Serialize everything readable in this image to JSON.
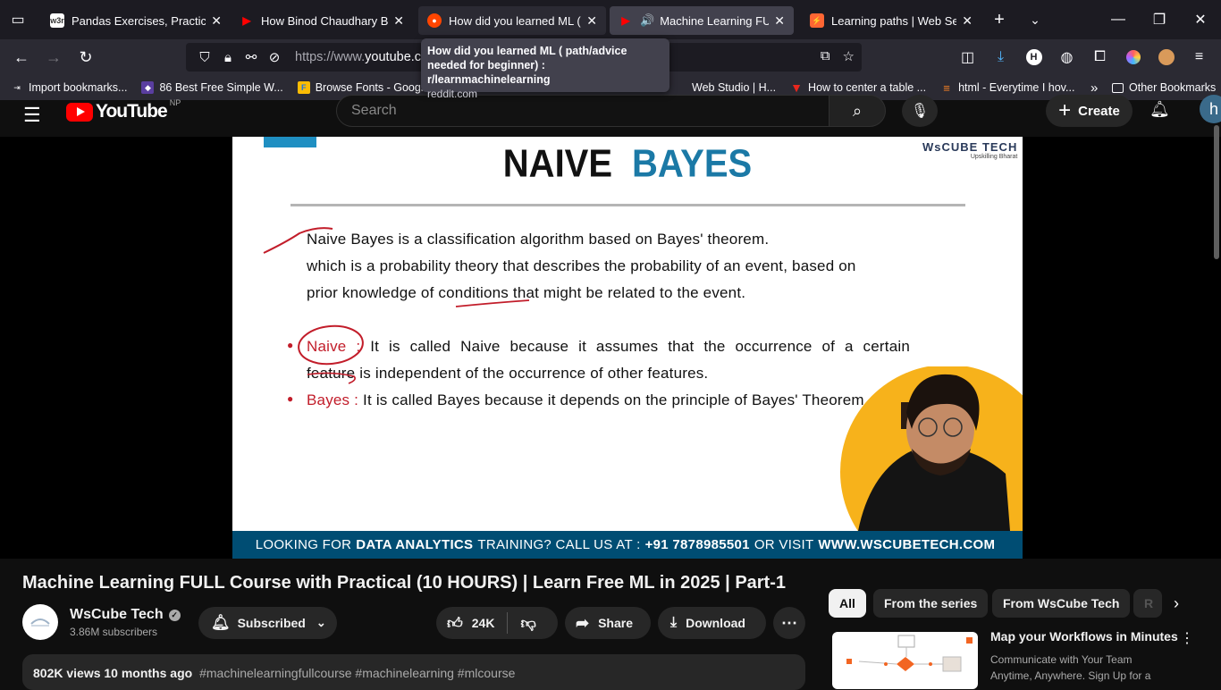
{
  "browser": {
    "tabs": [
      {
        "label": "Pandas Exercises, Practice, Sol",
        "favicon_text": "w3r",
        "favicon_color": "#fff"
      },
      {
        "label": "How Binod Chaudhary Becam",
        "favicon_text": "▶",
        "favicon_color": "#ff0000"
      },
      {
        "label": "How did you learned ML ( p",
        "favicon_text": "●",
        "favicon_color": "#ff4500"
      },
      {
        "label": "Machine Learning FULL C",
        "favicon_text": "▶",
        "favicon_color": "#ff0000"
      },
      {
        "label": "Learning paths | Web Security",
        "favicon_text": "⚡",
        "favicon_color": "#ff6633"
      }
    ],
    "url_prefix": "https://www.",
    "url_domain": "youtube.com",
    "tooltip": {
      "title": "How did you learned ML ( path/advice needed for beginner) : r/learnmachinelearning",
      "domain": "reddit.com"
    },
    "bookmarks": [
      {
        "label": "Import bookmarks...",
        "icon": "⇥"
      },
      {
        "label": "86 Best Free Simple W...",
        "icon": "◆"
      },
      {
        "label": "Browse Fonts - Googl...",
        "icon": "F"
      },
      {
        "label": "Web Studio | H...",
        "icon": ""
      },
      {
        "label": "How to center a table ...",
        "icon": "▼"
      },
      {
        "label": "html - Everytime I hov...",
        "icon": "≡"
      }
    ],
    "bookmarks_other": "Other Bookmarks"
  },
  "youtube": {
    "logo_text": "YouTube",
    "region": "NP",
    "search_placeholder": "Search",
    "create_label": "Create",
    "avatar_letter": "h"
  },
  "slide": {
    "title_part1": "NAIVE",
    "title_part2": "BAYES",
    "logo_line1": "WsCUBE TECH",
    "logo_line2": "Upskilling Bharat",
    "bullet1": "Naive Bayes is a classification algorithm based on Bayes' theorem.",
    "bullet2_line1": "which is a probability theory that describes the probability of an event, based on",
    "bullet2_line2": "prior knowledge of conditions that might be related to the event.",
    "naive_term": "Naive :",
    "naive_line1": "It is called Naive because it assumes that the occurrence of a certain",
    "naive_line2": "feature is independent of the occurrence of other features.",
    "bayes_term": "Bayes :",
    "bayes_line": "It is called Bayes because it depends on the principle of Bayes' Theorem.",
    "footer_a": "LOOKING FOR",
    "footer_b": "DATA ANALYTICS",
    "footer_c": "TRAINING? CALL US AT :",
    "footer_d": "+91 7878985501",
    "footer_e": "OR VISIT",
    "footer_f": "WWW.WSCUBETECH.COM"
  },
  "video": {
    "title": "Machine Learning FULL Course with Practical (10 HOURS) | Learn Free ML in 2025 | Part-1",
    "channel": "WsCube Tech",
    "subscribers": "3.86M subscribers",
    "subscribed_label": "Subscribed",
    "likes": "24K",
    "share_label": "Share",
    "download_label": "Download",
    "stats": "802K views  10 months ago",
    "tags": "#machinelearningfullcourse #machinelearning #mlcourse"
  },
  "sidebar": {
    "chips": [
      "All",
      "From the series",
      "From WsCube Tech",
      "R"
    ],
    "ad_title": "Map your Workflows in Minutes",
    "ad_desc": "Communicate with Your Team Anytime, Anywhere. Sign Up for a"
  }
}
